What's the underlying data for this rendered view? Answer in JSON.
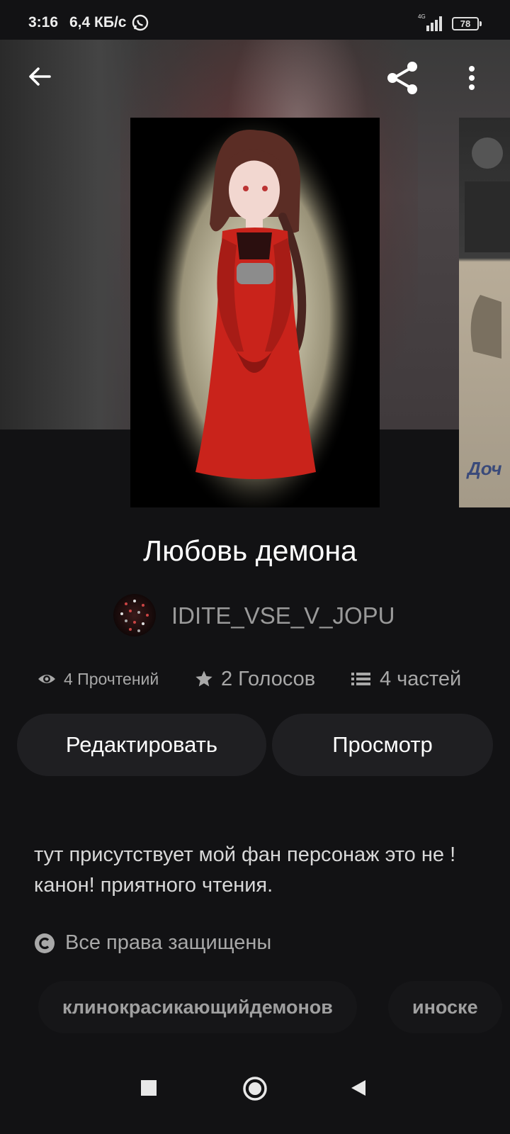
{
  "status_bar": {
    "time": "3:16",
    "network_speed": "6,4 КБ/с",
    "network_type": "4G",
    "battery": "78"
  },
  "toolbar": {
    "back_icon": "arrow-left-icon",
    "share_icon": "share-icon",
    "more_icon": "more-vertical-icon"
  },
  "story": {
    "title": "Любовь демона",
    "author": "IDITE_VSE_V_JOPU",
    "stats": {
      "reads": "4 Прочтений",
      "votes": "2 Голосов",
      "parts": "4 частей"
    },
    "description": "тут присутствует мой фан персонаж это не !канон!  приятного чтения.",
    "rights": "Все права защищены",
    "tags": [
      "клинокрасикающийдемонов",
      "иноске"
    ],
    "next_cover_text": "Доч"
  },
  "buttons": {
    "edit": "Редактировать",
    "view": "Просмотр"
  },
  "nav": {
    "recents_icon": "square-icon",
    "home_icon": "circle-icon",
    "back_icon": "triangle-back-icon"
  },
  "colors": {
    "background": "#121214",
    "button_bg": "#1f1f22",
    "muted_text": "#a8a8a8"
  }
}
